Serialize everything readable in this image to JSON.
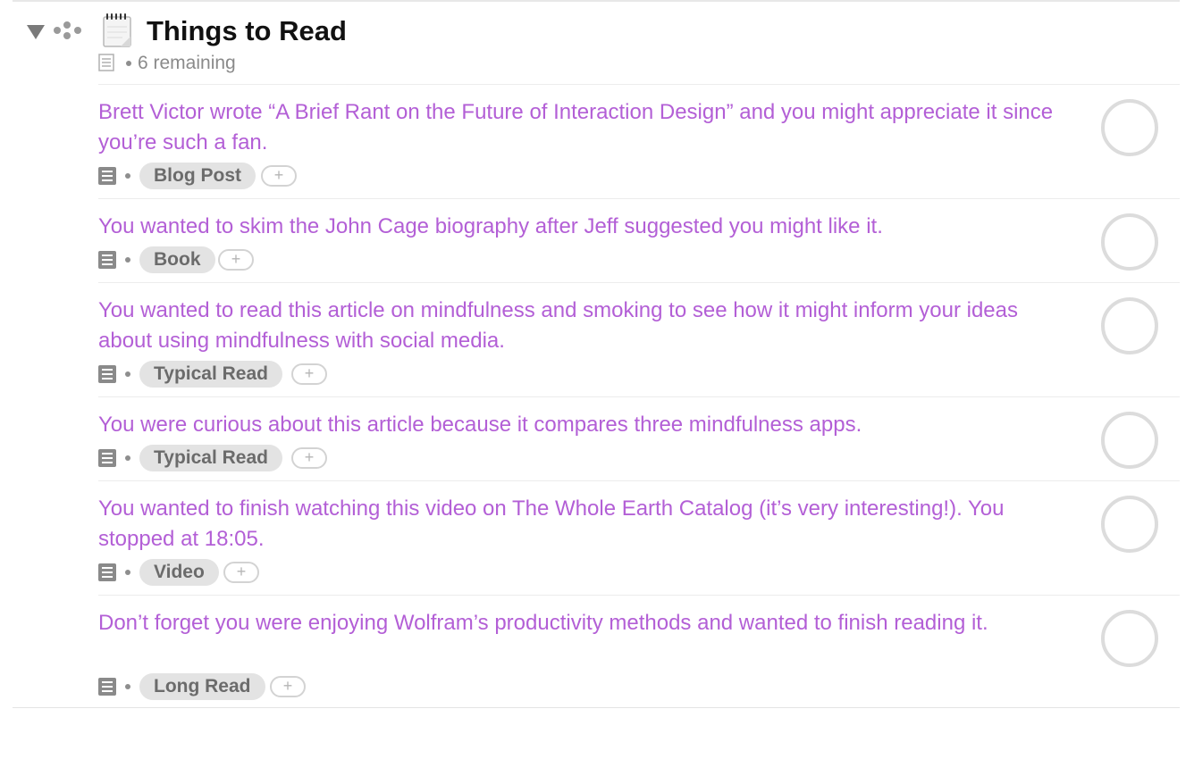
{
  "project": {
    "title": "Things to Read",
    "remaining": "6 remaining",
    "icon": "notepad-icon",
    "add_tag_label": "+"
  },
  "colors": {
    "task_text": "#b35fd6",
    "title_text": "#111111",
    "tag_bg": "#e3e3e3",
    "tag_text": "#6b6b6b",
    "checkbox_border": "#dcdcdc"
  },
  "tasks": [
    {
      "title": "Brett Victor wrote “A Brief Rant on the Future of Interaction Design” and you might appreciate it since you’re such a fan.",
      "tag": "Blog Post",
      "completed": false
    },
    {
      "title": "You wanted to skim the John Cage biography after Jeff suggested you might like it.",
      "tag": "Book",
      "completed": false
    },
    {
      "title": "You wanted to read this article on mindfulness and smoking to see how it might inform your ideas about using mindfulness with social media.",
      "tag": "Typical Read",
      "completed": false
    },
    {
      "title": "You were curious about this article because it compares three mindfulness apps.",
      "tag": "Typical Read",
      "completed": false
    },
    {
      "title": "You wanted to finish watching this video on The Whole Earth Catalog (it’s very interesting!). You stopped at 18:05.",
      "tag": "Video",
      "completed": false
    },
    {
      "title": "Don’t forget you were enjoying Wolfram’s productivity methods and wanted to finish reading it.",
      "tag": "Long Read",
      "completed": false
    }
  ]
}
